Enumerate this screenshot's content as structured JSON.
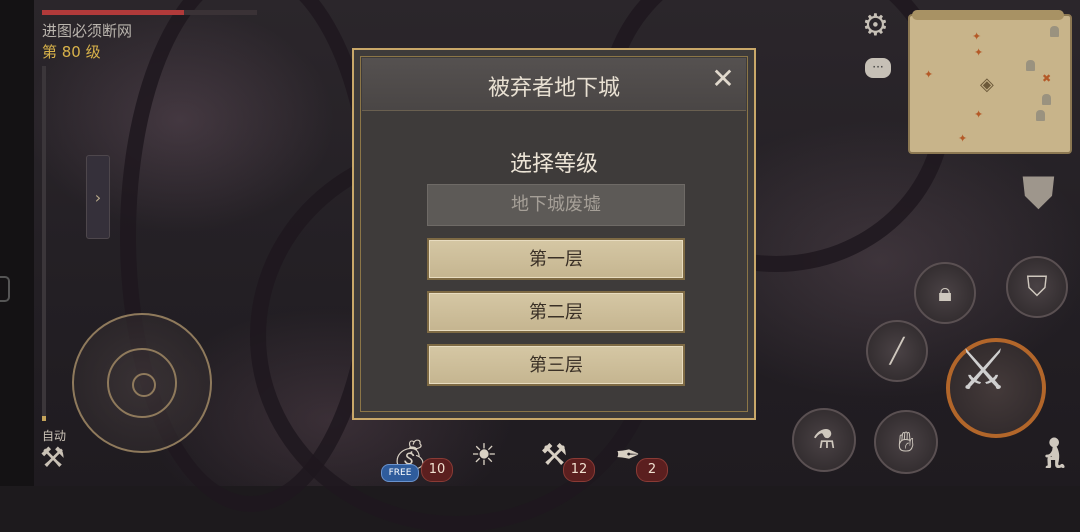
{
  "player": {
    "name": "进图必须断网",
    "level": "第 80 级",
    "hp_fraction": 0.66
  },
  "controls": {
    "auto_label": "自动"
  },
  "hotbar": [
    {
      "icon": "money-bag-icon",
      "badge": "FREE",
      "count": "10"
    },
    {
      "icon": "sun-tome-icon",
      "count": ""
    },
    {
      "icon": "hammer-scroll-icon",
      "count": "12"
    },
    {
      "icon": "feather-scroll-icon",
      "count": "2"
    }
  ],
  "dialog": {
    "title": "被弃者地下城",
    "close_label": "✕",
    "subtitle": "选择等级",
    "options": [
      {
        "label": "地下城废墟",
        "enabled": false
      },
      {
        "label": "第一层",
        "enabled": true
      },
      {
        "label": "第二层",
        "enabled": true
      },
      {
        "label": "第三层",
        "enabled": true
      }
    ]
  },
  "colors": {
    "gold_frame": "#c9a869",
    "button_fill": "#d5c7a4",
    "hp": "#b13a3a",
    "level_text": "#d8b24a"
  }
}
